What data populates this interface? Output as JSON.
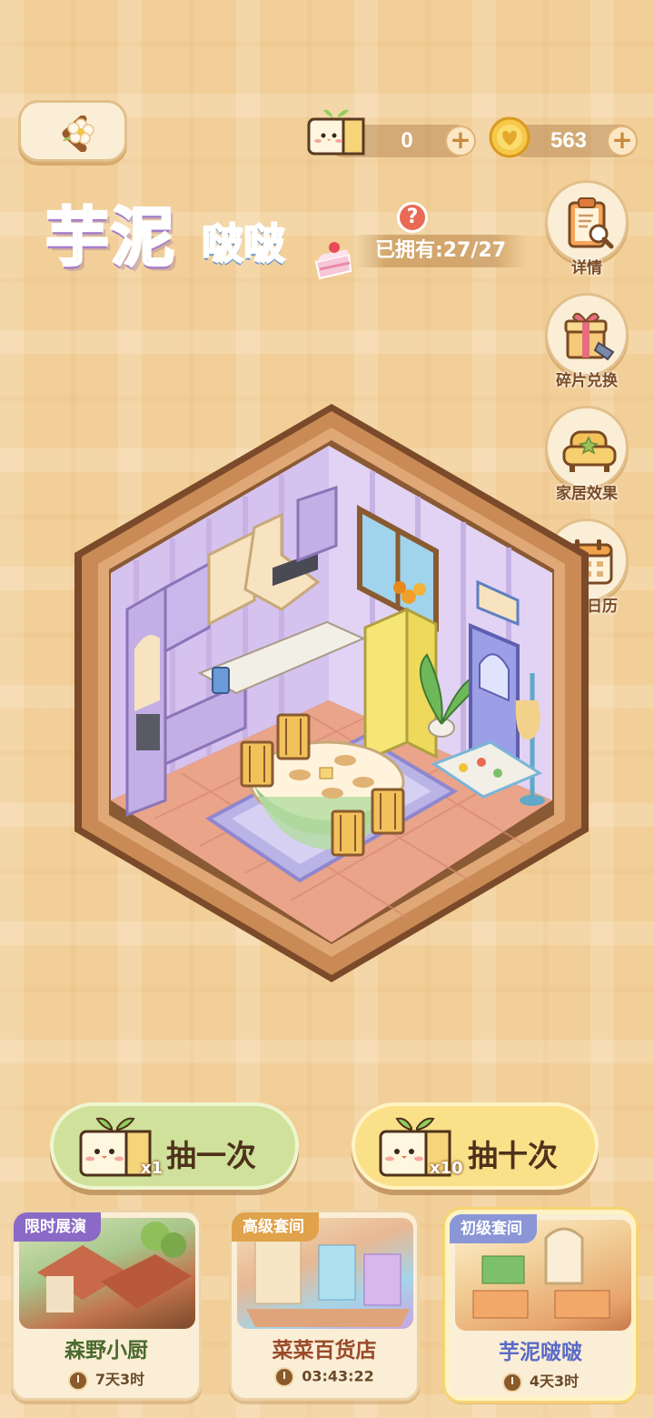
{
  "header": {
    "back_icon": "chevron-left-icon",
    "tickets": {
      "icon": "ticket-icon",
      "value": "0"
    },
    "coins": {
      "icon": "coin-icon",
      "value": "563"
    }
  },
  "title": {
    "main": "芋泥",
    "sub": "啵啵",
    "owned": "已拥有:27/27"
  },
  "side_menu": [
    {
      "label": "详情",
      "icon": "clipboard-search-icon"
    },
    {
      "label": "碎片兑换",
      "icon": "gift-box-icon"
    },
    {
      "label": "家居效果",
      "icon": "sofa-icon"
    },
    {
      "label": "轮换日历",
      "icon": "calendar-icon"
    }
  ],
  "draw": {
    "one": {
      "label": "抽一次",
      "multiplier": "x1"
    },
    "ten": {
      "label": "抽十次",
      "multiplier": "x10"
    }
  },
  "cards": [
    {
      "badge": "限时展演",
      "name": "森野小厨",
      "timer": "7天3时",
      "badge_color": "#8a6ac6"
    },
    {
      "badge": "高级套间",
      "name": "菜菜百货店",
      "timer": "03:43:22",
      "badge_color": "#e0a24a"
    },
    {
      "badge": "初级套间",
      "name": "芋泥啵啵",
      "timer": "4天3时",
      "badge_color": "#8a96d6"
    }
  ],
  "colors": {
    "background": "#f2cf98",
    "frame_wood": "#b9784a",
    "room_wall": "#d9c6ef"
  }
}
